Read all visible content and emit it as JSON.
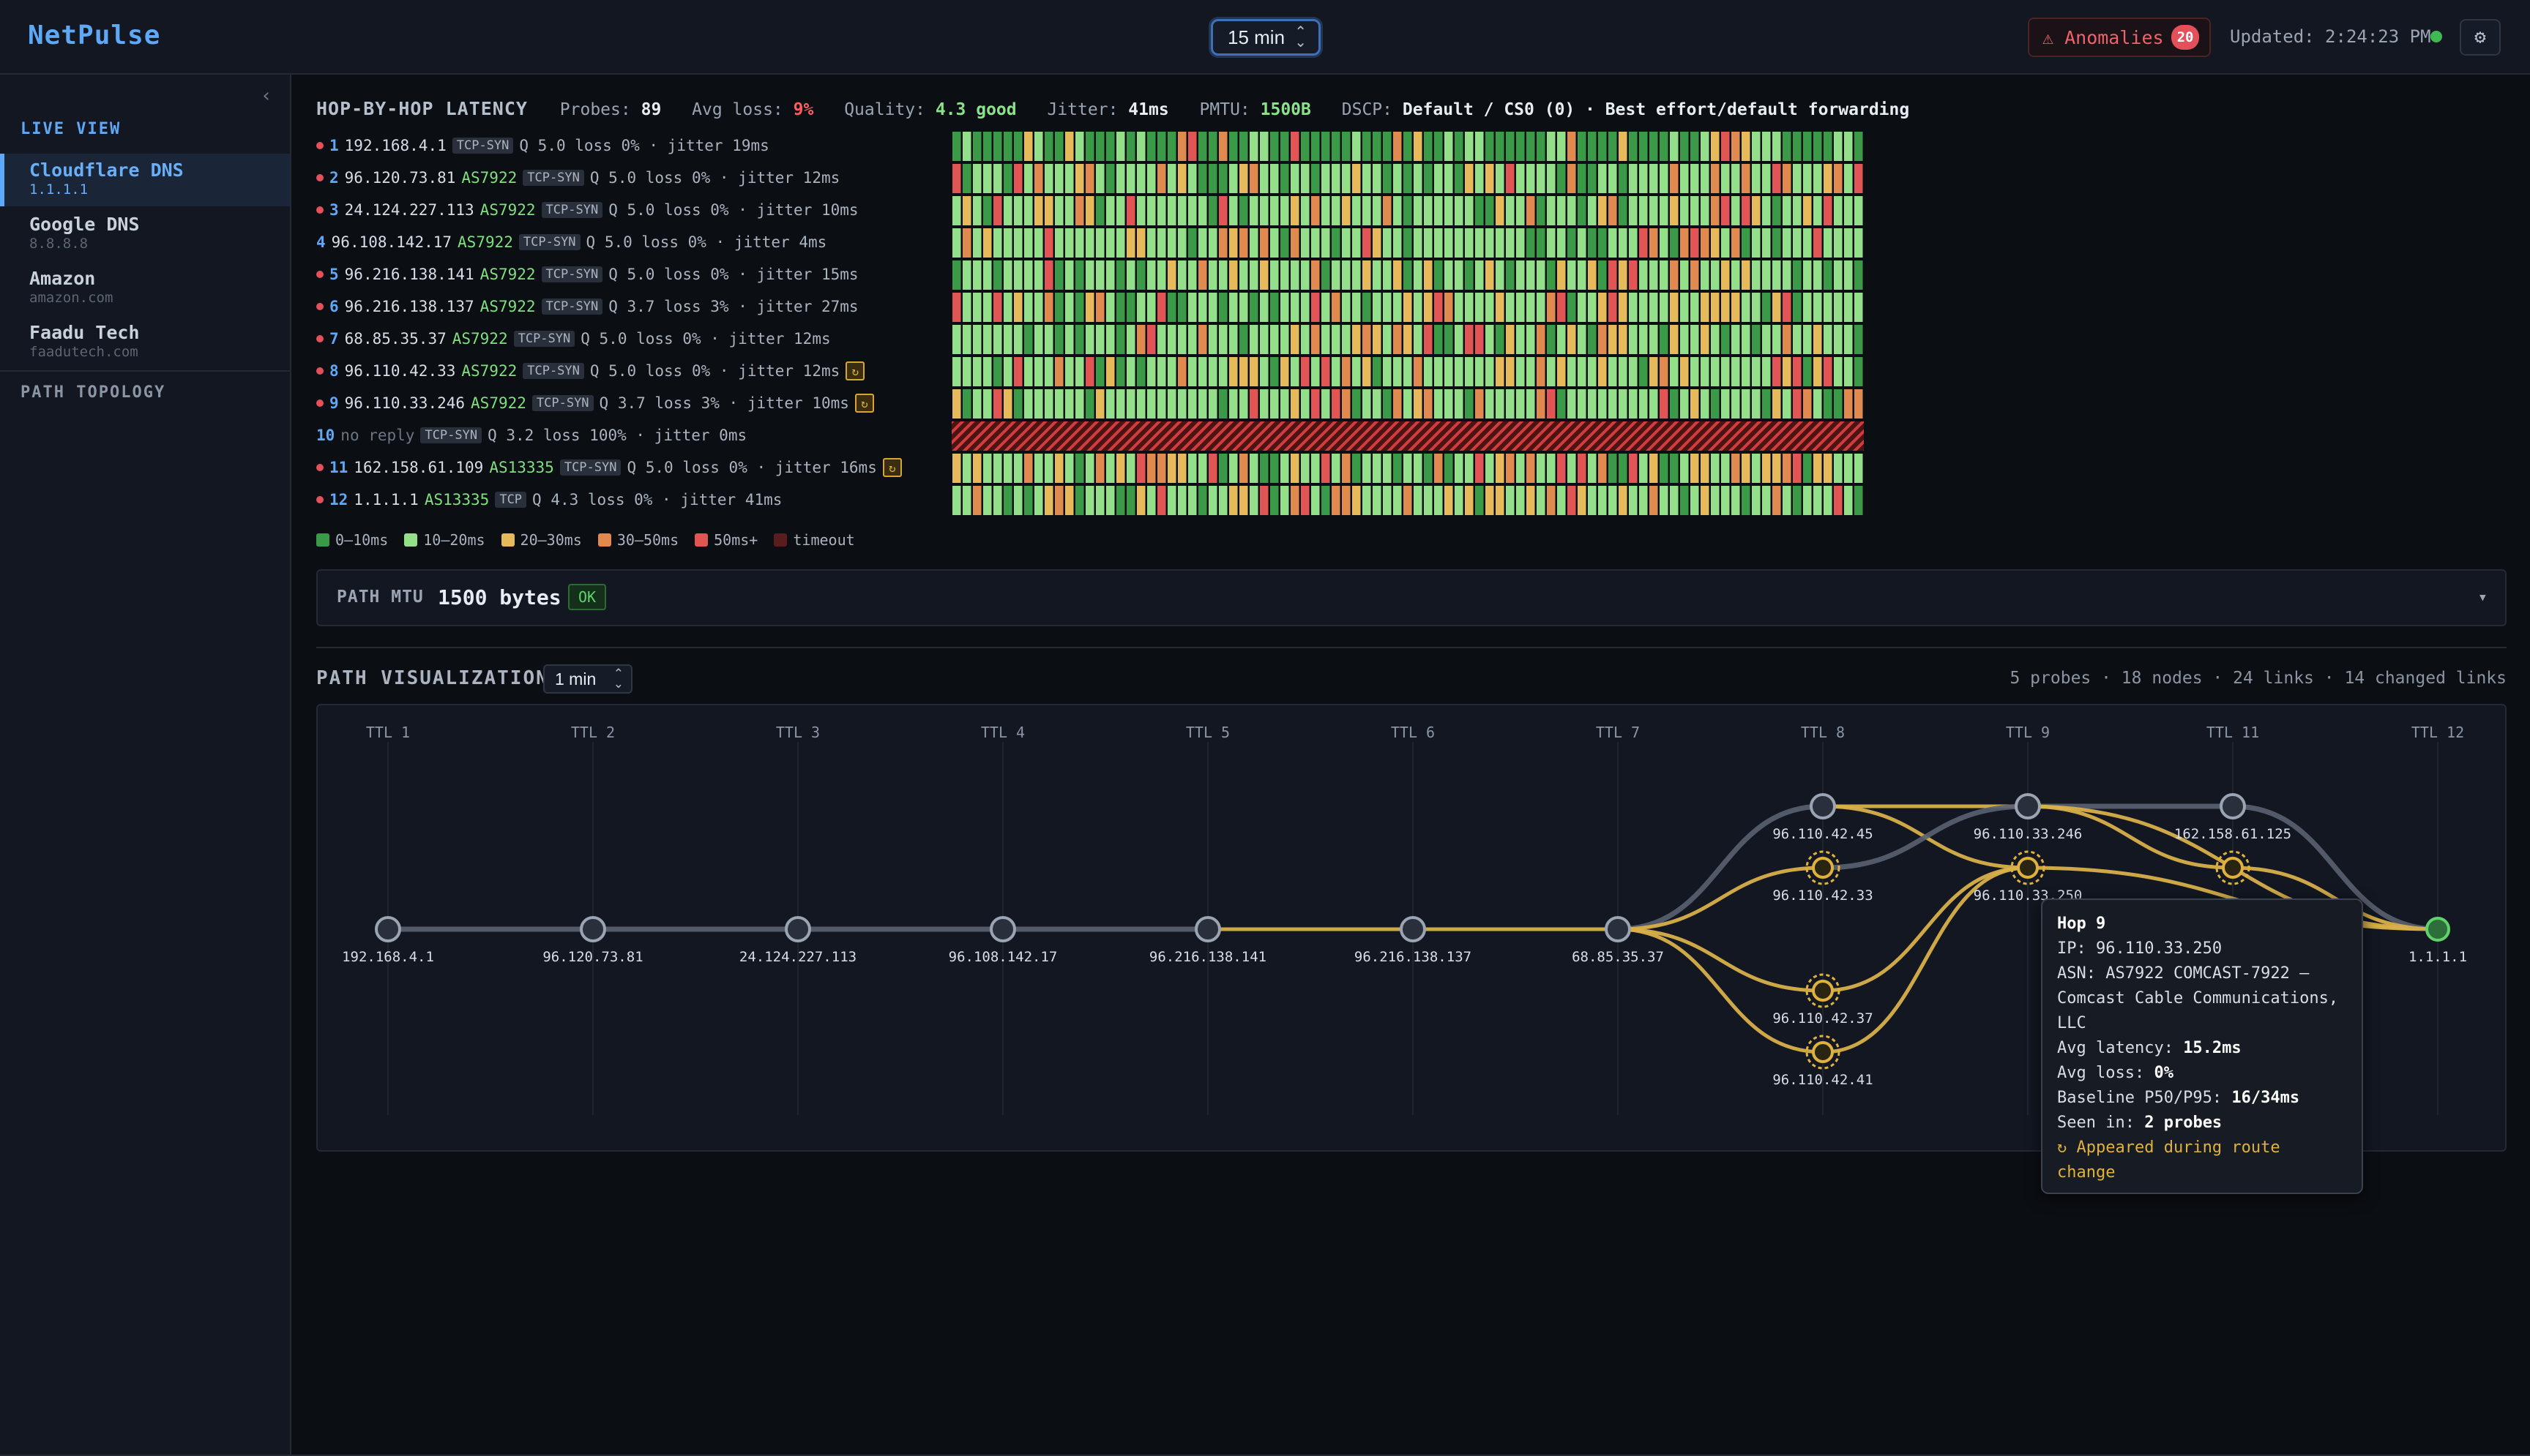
{
  "app": {
    "brand": "NetPulse",
    "range_select": "15 min",
    "anomalies_label": "⚠ Anomalies",
    "anomalies_count": "20",
    "updated": "Updated: 2:24:23 PM",
    "settings_icon": "⚙",
    "status_color": "#3fb950"
  },
  "sidebar": {
    "collapse_icon": "‹",
    "live_title": "LIVE VIEW",
    "topology_title": "PATH TOPOLOGY",
    "items": [
      {
        "name": "Cloudflare DNS",
        "sub": "1.1.1.1",
        "active": true
      },
      {
        "name": "Google DNS",
        "sub": "8.8.8.8",
        "active": false
      },
      {
        "name": "Amazon",
        "sub": "amazon.com",
        "active": false
      },
      {
        "name": "Faadu Tech",
        "sub": "faadutech.com",
        "active": false
      }
    ]
  },
  "hop_header": {
    "title": "HOP-BY-HOP LATENCY",
    "probes_label": "Probes:",
    "probes": "89",
    "loss_label": "Avg loss:",
    "loss": "9%",
    "quality_label": "Quality:",
    "quality": "4.3 good",
    "jitter_label": "Jitter:",
    "jitter": "41ms",
    "pmtu_label": "PMTU:",
    "pmtu": "1500B",
    "dscp_label": "DSCP:",
    "dscp": "Default / CS0 (0) · Best effort/default forwarding"
  },
  "hops": [
    {
      "dot": true,
      "num": "1",
      "ip": "192.168.4.1",
      "asn": "",
      "proto": "TCP-SYN",
      "stats": "Q 5.0 loss 0% · jitter 19ms",
      "changed": false
    },
    {
      "dot": true,
      "num": "2",
      "ip": "96.120.73.81",
      "asn": "AS7922",
      "proto": "TCP-SYN",
      "stats": "Q 5.0 loss 0% · jitter 12ms",
      "changed": false
    },
    {
      "dot": true,
      "num": "3",
      "ip": "24.124.227.113",
      "asn": "AS7922",
      "proto": "TCP-SYN",
      "stats": "Q 5.0 loss 0% · jitter 10ms",
      "changed": false
    },
    {
      "dot": false,
      "num": "4",
      "ip": "96.108.142.17",
      "asn": "AS7922",
      "proto": "TCP-SYN",
      "stats": "Q 5.0 loss 0% · jitter 4ms",
      "changed": false
    },
    {
      "dot": true,
      "num": "5",
      "ip": "96.216.138.141",
      "asn": "AS7922",
      "proto": "TCP-SYN",
      "stats": "Q 5.0 loss 0% · jitter 15ms",
      "changed": false
    },
    {
      "dot": true,
      "num": "6",
      "ip": "96.216.138.137",
      "asn": "AS7922",
      "proto": "TCP-SYN",
      "stats": "Q 3.7 loss 3% · jitter 27ms",
      "changed": false
    },
    {
      "dot": true,
      "num": "7",
      "ip": "68.85.35.37",
      "asn": "AS7922",
      "proto": "TCP-SYN",
      "stats": "Q 5.0 loss 0% · jitter 12ms",
      "changed": false
    },
    {
      "dot": true,
      "num": "8",
      "ip": "96.110.42.33",
      "asn": "AS7922",
      "proto": "TCP-SYN",
      "stats": "Q 5.0 loss 0% · jitter 12ms",
      "changed": true
    },
    {
      "dot": true,
      "num": "9",
      "ip": "96.110.33.246",
      "asn": "AS7922",
      "proto": "TCP-SYN",
      "stats": "Q 3.7 loss 3% · jitter 10ms",
      "changed": true
    },
    {
      "dot": false,
      "num": "10",
      "ip": "no reply",
      "asn": "",
      "proto": "TCP-SYN",
      "stats": "Q 3.2 loss 100% · jitter 0ms",
      "changed": false,
      "noreply": true
    },
    {
      "dot": true,
      "num": "11",
      "ip": "162.158.61.109",
      "asn": "AS13335",
      "proto": "TCP-SYN",
      "stats": "Q 5.0 loss 0% · jitter 16ms",
      "changed": true
    },
    {
      "dot": true,
      "num": "12",
      "ip": "1.1.1.1",
      "asn": "AS13335",
      "proto": "TCP",
      "stats": "Q 4.3 loss 0% · jitter 41ms",
      "changed": false
    }
  ],
  "legend": [
    {
      "label": "0–10ms",
      "color": "#3a9a48"
    },
    {
      "label": "10–20ms",
      "color": "#94e08a"
    },
    {
      "label": "20–30ms",
      "color": "#e6b95a"
    },
    {
      "label": "30–50ms",
      "color": "#e08a50"
    },
    {
      "label": "50ms+",
      "color": "#e25555"
    },
    {
      "label": "timeout",
      "color": "#5a1d1d"
    }
  ],
  "mtu": {
    "label": "PATH MTU",
    "value": "1500 bytes",
    "status": "OK",
    "toggle_icon": "▾"
  },
  "path_viz": {
    "title": "PATH VISUALIZATION",
    "interval": "1 min",
    "summary": "5 probes · 18 nodes · 24 links · 14 changed links",
    "ttl_labels": [
      "TTL 1",
      "TTL 2",
      "TTL 3",
      "TTL 4",
      "TTL 5",
      "TTL 6",
      "TTL 7",
      "TTL 8",
      "TTL 9",
      "TTL 11",
      "TTL 12"
    ],
    "nodes": [
      {
        "id": "n1",
        "ttl": 0,
        "lane": 0,
        "ip": "192.168.4.1",
        "kind": "normal"
      },
      {
        "id": "n2",
        "ttl": 1,
        "lane": 0,
        "ip": "96.120.73.81",
        "kind": "normal"
      },
      {
        "id": "n3",
        "ttl": 2,
        "lane": 0,
        "ip": "24.124.227.113",
        "kind": "normal"
      },
      {
        "id": "n4",
        "ttl": 3,
        "lane": 0,
        "ip": "96.108.142.17",
        "kind": "normal"
      },
      {
        "id": "n5",
        "ttl": 4,
        "lane": 0,
        "ip": "96.216.138.141",
        "kind": "normal"
      },
      {
        "id": "n6",
        "ttl": 5,
        "lane": 0,
        "ip": "96.216.138.137",
        "kind": "normal"
      },
      {
        "id": "n7",
        "ttl": 6,
        "lane": 0,
        "ip": "68.85.35.37",
        "kind": "normal"
      },
      {
        "id": "n8a",
        "ttl": 7,
        "lane": -1,
        "ip": "96.110.42.45",
        "kind": "normal"
      },
      {
        "id": "n8b",
        "ttl": 7,
        "lane": -0.5,
        "ip": "96.110.42.33",
        "kind": "changed"
      },
      {
        "id": "n8c",
        "ttl": 7,
        "lane": 0.5,
        "ip": "96.110.42.37",
        "kind": "changed"
      },
      {
        "id": "n8d",
        "ttl": 7,
        "lane": 1,
        "ip": "96.110.42.41",
        "kind": "changed"
      },
      {
        "id": "n9a",
        "ttl": 8,
        "lane": -1,
        "ip": "96.110.33.246",
        "kind": "normal"
      },
      {
        "id": "n9b",
        "ttl": 8,
        "lane": -0.5,
        "ip": "96.110.33.250",
        "kind": "changed"
      },
      {
        "id": "n11a",
        "ttl": 9,
        "lane": -1,
        "ip": "162.158.61.125",
        "kind": "normal"
      },
      {
        "id": "n11b",
        "ttl": 9,
        "lane": -0.5,
        "ip": "",
        "kind": "changed"
      },
      {
        "id": "n12",
        "ttl": 10,
        "lane": 0,
        "ip": "1.1.1.1",
        "kind": "dest"
      }
    ],
    "links": [
      [
        "n1",
        "n2",
        "gray"
      ],
      [
        "n2",
        "n3",
        "gray"
      ],
      [
        "n3",
        "n4",
        "gray"
      ],
      [
        "n4",
        "n5",
        "gray"
      ],
      [
        "n5",
        "n6",
        "gold"
      ],
      [
        "n6",
        "n7",
        "gold"
      ],
      [
        "n7",
        "n8a",
        "gray"
      ],
      [
        "n7",
        "n8b",
        "gold"
      ],
      [
        "n7",
        "n8c",
        "gold"
      ],
      [
        "n7",
        "n8d",
        "gold"
      ],
      [
        "n8a",
        "n9a",
        "gold"
      ],
      [
        "n8a",
        "n9b",
        "gold"
      ],
      [
        "n8b",
        "n9a",
        "gray"
      ],
      [
        "n8c",
        "n9b",
        "gold"
      ],
      [
        "n8d",
        "n9b",
        "gold"
      ],
      [
        "n9a",
        "n11a",
        "gray"
      ],
      [
        "n9a",
        "n11b",
        "gold"
      ],
      [
        "n9a",
        "n12",
        "gold"
      ],
      [
        "n9b",
        "n12",
        "gold"
      ],
      [
        "n11a",
        "n12",
        "gray"
      ],
      [
        "n11b",
        "n12",
        "gold"
      ]
    ]
  },
  "tooltip": {
    "title": "Hop 9",
    "ip_line": "IP: 96.110.33.250",
    "asn_line": "ASN: AS7922 COMCAST-7922 – Comcast Cable Communications, LLC",
    "latency_label": "Avg latency: ",
    "latency": "15.2ms",
    "loss_label": "Avg loss: ",
    "loss": "0%",
    "baseline_label": "Baseline P50/P95: ",
    "baseline": "16/34ms",
    "seen_label": "Seen in: ",
    "seen": "2 probes",
    "change_note": "↻ Appeared during route change"
  }
}
